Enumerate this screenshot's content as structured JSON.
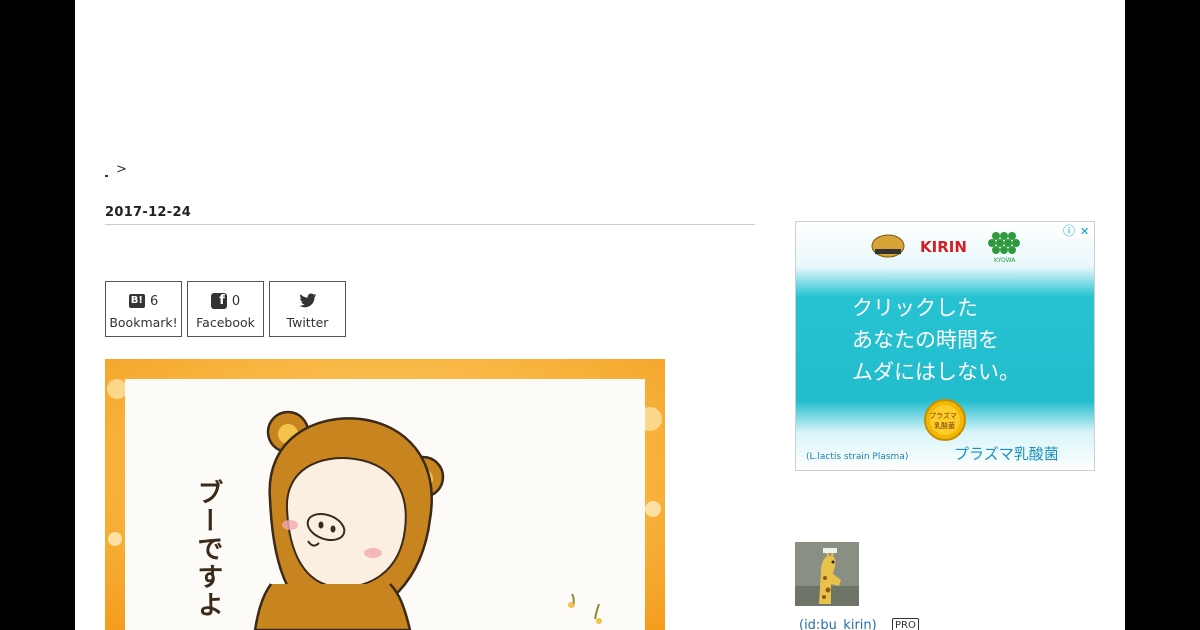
{
  "breadcrumb": {
    "separator": ">"
  },
  "entry": {
    "date": "2017-12-24"
  },
  "share": {
    "bookmark": {
      "count": "6",
      "label": "Bookmark!",
      "icon": "hatena-bookmark-icon"
    },
    "facebook": {
      "count": "0",
      "label": "Facebook",
      "icon": "facebook-icon"
    },
    "twitter": {
      "label": "Twitter",
      "icon": "twitter-icon"
    }
  },
  "illustration": {
    "caption": "ブーですよ"
  },
  "ad": {
    "brand": "KIRIN",
    "partner": "KYOWA",
    "line1": "クリックした",
    "line2": "あなたの時間を",
    "line3": "ムダにはしない。",
    "badge_line1": "プラズマ",
    "badge_line2": "乳酸菌",
    "footer_latin": "(L.lactis strain Plasma)",
    "footer_jp": "プラズマ乳酸菌",
    "info_icon": "ⓘ",
    "close_icon": "✕"
  },
  "profile": {
    "id": "(id:bu_kirin)",
    "badge": "PRO"
  },
  "colors": {
    "ad_teal": "#1fbfd0",
    "frame_orange": "#f5a623",
    "bear_brown": "#c8841f"
  }
}
